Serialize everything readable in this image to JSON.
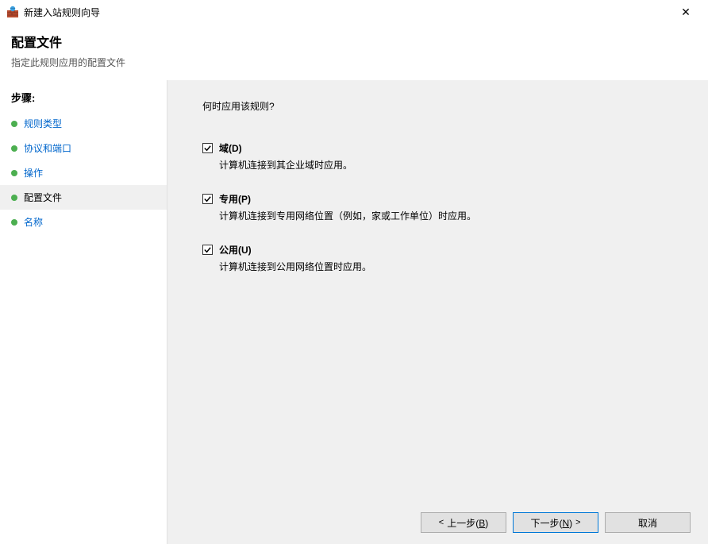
{
  "window": {
    "title": "新建入站规则向导",
    "close_label": "✕"
  },
  "header": {
    "title": "配置文件",
    "subtitle": "指定此规则应用的配置文件"
  },
  "sidebar": {
    "heading": "步骤:",
    "items": [
      {
        "label": "规则类型",
        "active": false
      },
      {
        "label": "协议和端口",
        "active": false
      },
      {
        "label": "操作",
        "active": false
      },
      {
        "label": "配置文件",
        "active": true
      },
      {
        "label": "名称",
        "active": false
      }
    ]
  },
  "main": {
    "prompt": "何时应用该规则?",
    "profiles": [
      {
        "checked": true,
        "label": "域(D)",
        "desc": "计算机连接到其企业域时应用。"
      },
      {
        "checked": true,
        "label": "专用(P)",
        "desc": "计算机连接到专用网络位置（例如，家或工作单位）时应用。"
      },
      {
        "checked": true,
        "label": "公用(U)",
        "desc": "计算机连接到公用网络位置时应用。"
      }
    ]
  },
  "footer": {
    "back": {
      "text": "上一步(",
      "key": "B",
      "end": ")"
    },
    "next": {
      "text": "下一步(",
      "key": "N",
      "end": ")"
    },
    "cancel": "取消"
  }
}
